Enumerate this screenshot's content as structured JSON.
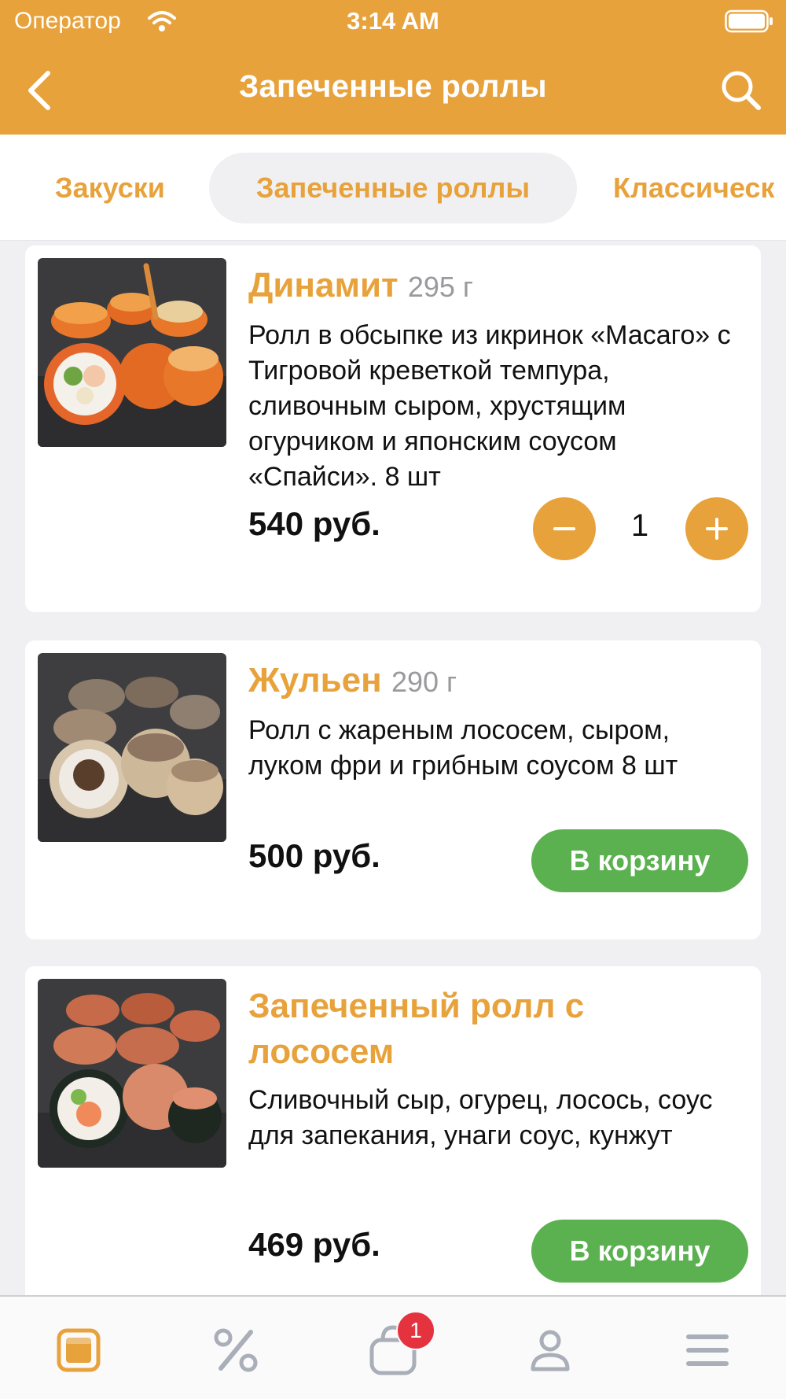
{
  "status_bar": {
    "carrier": "Оператор",
    "time": "3:14 AM"
  },
  "nav": {
    "title": "Запеченные роллы"
  },
  "categories": [
    {
      "label": "Закуски"
    },
    {
      "label": "Запеченные роллы",
      "selected": true
    },
    {
      "label": "Классическ"
    }
  ],
  "products": [
    {
      "name": "Динамит",
      "weight": "295 г",
      "description": "Ролл в обсыпке из икринок «Масаго» с Тигровой креветкой темпура, сливочным сыром, хрустящим огурчиком и японским соусом «Спайси». 8 шт",
      "price": "540 руб.",
      "quantity": "1"
    },
    {
      "name": "Жульен",
      "weight": "290 г",
      "description": "Ролл с жареным лососем, сыром, луком фри и грибным соусом 8 шт",
      "price": "500 руб.",
      "cart_label": "В корзину"
    },
    {
      "name": "Запеченный ролл с лососем",
      "weight": "",
      "description": "Сливочный сыр, огурец, лосось, соус для запекания, унаги соус, кунжут",
      "price": "469 руб.",
      "cart_label": "В корзину"
    }
  ],
  "tabbar": {
    "items": [
      {
        "icon": "menu-icon",
        "active": true
      },
      {
        "icon": "percent-icon"
      },
      {
        "icon": "cart-icon",
        "badge": "1"
      },
      {
        "icon": "profile-icon"
      },
      {
        "icon": "hamburger-icon"
      }
    ]
  },
  "colors": {
    "accent": "#e8a23c",
    "cart_button": "#5bb150",
    "badge": "#e5323f",
    "inactive_icon": "#a9aeb8"
  }
}
